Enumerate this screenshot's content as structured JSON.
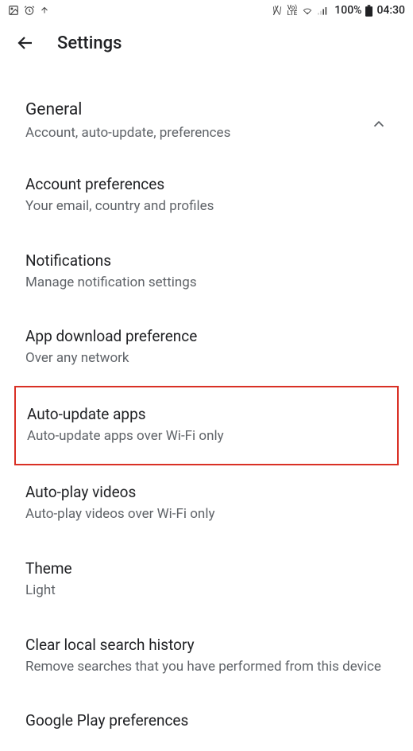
{
  "statusBar": {
    "battery": "100%",
    "time": "04:30",
    "lte_top": "Vo)",
    "lte_bottom": "LTE"
  },
  "appBar": {
    "title": "Settings"
  },
  "section": {
    "title": "General",
    "subtitle": "Account, auto-update, preferences"
  },
  "items": [
    {
      "title": "Account preferences",
      "subtitle": "Your email, country and profiles"
    },
    {
      "title": "Notifications",
      "subtitle": "Manage notification settings"
    },
    {
      "title": "App download preference",
      "subtitle": "Over any network"
    },
    {
      "title": "Auto-update apps",
      "subtitle": "Auto-update apps over Wi-Fi only"
    },
    {
      "title": "Auto-play videos",
      "subtitle": "Auto-play videos over Wi-Fi only"
    },
    {
      "title": "Theme",
      "subtitle": "Light"
    },
    {
      "title": "Clear local search history",
      "subtitle": "Remove searches that you have performed from this device"
    },
    {
      "title": "Google Play preferences",
      "subtitle": ""
    }
  ]
}
